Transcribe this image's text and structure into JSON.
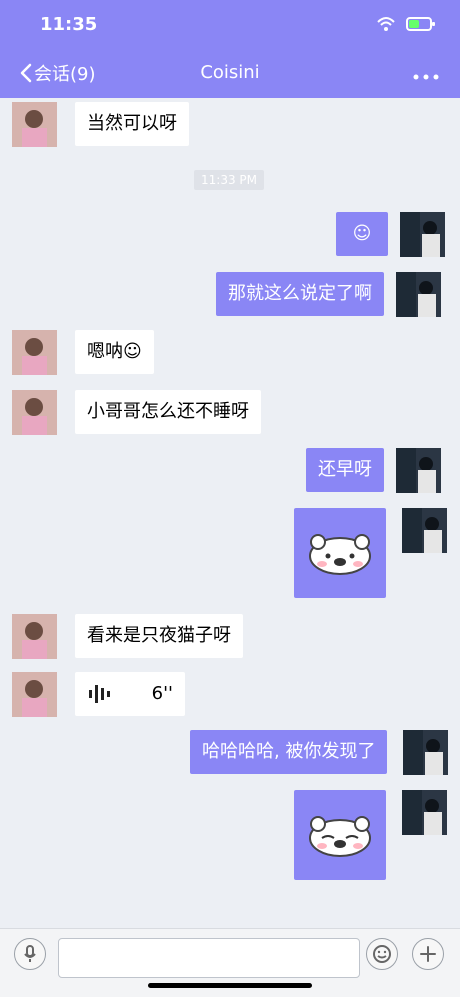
{
  "status": {
    "time": "11:35"
  },
  "nav": {
    "back_label": "会话(9)",
    "title": "Coisini"
  },
  "chat": {
    "timestamp": "11:33 PM",
    "messages": [
      {
        "side": "left",
        "text": "当然可以呀"
      },
      {
        "side": "right",
        "text": "☺"
      },
      {
        "side": "right",
        "text": "那就这么说定了啊"
      },
      {
        "side": "left",
        "text": "嗯呐☺"
      },
      {
        "side": "left",
        "text": "小哥哥怎么还不睡呀"
      },
      {
        "side": "right",
        "text": "还早呀"
      },
      {
        "side": "right",
        "sticker": "bear-sticker"
      },
      {
        "side": "left",
        "text": "看来是只夜猫子呀"
      },
      {
        "side": "left",
        "voice_duration": "6''"
      },
      {
        "side": "right",
        "text": "哈哈哈哈, 被你发现了"
      },
      {
        "side": "right",
        "sticker": "bear-sticker"
      }
    ]
  },
  "input": {
    "placeholder": ""
  },
  "icons": {
    "mic": "microphone-icon",
    "emoji": "emoji-icon",
    "plus": "plus-icon"
  },
  "colors": {
    "accent": "#8a86f5",
    "background": "#eceff4"
  }
}
